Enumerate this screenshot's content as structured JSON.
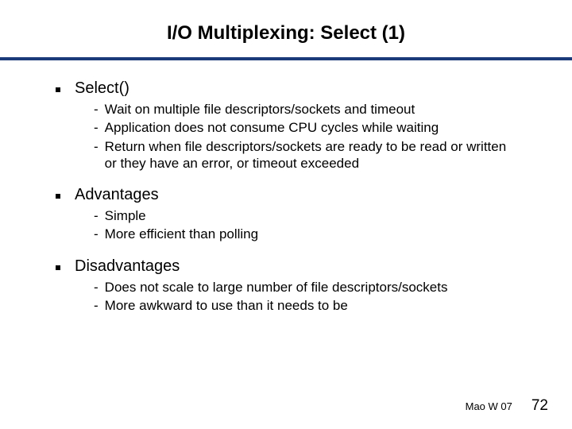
{
  "title": "I/O Multiplexing: Select (1)",
  "sections": [
    {
      "label": "Select()",
      "items": [
        "Wait on multiple file descriptors/sockets and timeout",
        "Application does not consume CPU cycles while waiting",
        "Return when file descriptors/sockets are ready to be read or written or they have an error, or timeout exceeded"
      ]
    },
    {
      "label": "Advantages",
      "items": [
        "Simple",
        "More efficient than polling"
      ]
    },
    {
      "label": "Disadvantages",
      "items": [
        "Does not scale to large number of file descriptors/sockets",
        "More awkward to use than it needs to be"
      ]
    }
  ],
  "footer": {
    "author": "Mao W 07",
    "page": "72"
  }
}
